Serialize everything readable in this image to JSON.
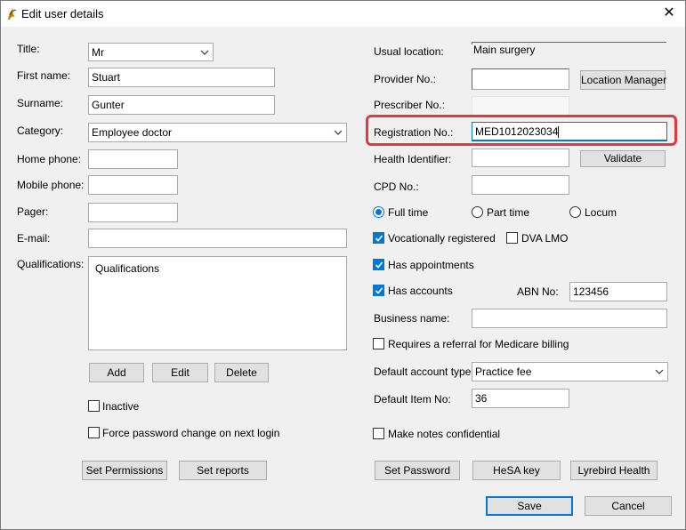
{
  "window": {
    "title": "Edit user details",
    "close_glyph": "✕"
  },
  "left": {
    "title_label": "Title:",
    "title_value": "Mr",
    "first_name_label": "First name:",
    "first_name_value": "Stuart",
    "surname_label": "Surname:",
    "surname_value": "Gunter",
    "category_label": "Category:",
    "category_value": "Employee doctor",
    "home_phone_label": "Home phone:",
    "home_phone_value": "",
    "mobile_phone_label": "Mobile phone:",
    "mobile_phone_value": "",
    "pager_label": "Pager:",
    "pager_value": "",
    "email_label": "E-mail:",
    "email_value": "",
    "qualifications_label": "Qualifications:",
    "qualifications_value": "Qualifications",
    "add_label": "Add",
    "edit_label": "Edit",
    "delete_label": "Delete",
    "inactive_label": "Inactive",
    "inactive_checked": false,
    "force_pw_label": "Force password change on next login",
    "force_pw_checked": false,
    "set_permissions_label": "Set Permissions",
    "set_reports_label": "Set reports"
  },
  "right": {
    "usual_location_label": "Usual location:",
    "usual_location_value": "Main surgery",
    "provider_no_label": "Provider No.:",
    "provider_no_value": "",
    "location_manager_label": "Location Manager",
    "prescriber_no_label": "Prescriber No.:",
    "prescriber_no_value": "",
    "registration_no_label": "Registration No.:",
    "registration_no_value": "MED1012023034",
    "health_identifier_label": "Health Identifier:",
    "health_identifier_value": "",
    "validate_label": "Validate",
    "cpd_no_label": "CPD No.:",
    "cpd_no_value": "",
    "full_time_label": "Full time",
    "part_time_label": "Part time",
    "locum_label": "Locum",
    "employment_selected": "Full time",
    "vocationally_registered_label": "Vocationally registered",
    "vocationally_registered_checked": true,
    "dva_lmo_label": "DVA LMO",
    "dva_lmo_checked": false,
    "has_appointments_label": "Has appointments",
    "has_appointments_checked": true,
    "has_accounts_label": "Has accounts",
    "has_accounts_checked": true,
    "abn_label": "ABN No:",
    "abn_value": "123456",
    "business_name_label": "Business name:",
    "business_name_value": "",
    "requires_referral_label": "Requires a referral for Medicare billing",
    "requires_referral_checked": false,
    "default_account_type_label": "Default account type:",
    "default_account_type_value": "Practice fee",
    "default_item_no_label": "Default Item No:",
    "default_item_no_value": "36",
    "make_notes_confidential_label": "Make notes confidential",
    "make_notes_confidential_checked": false,
    "set_password_label": "Set Password",
    "hesa_key_label": "HeSA key",
    "lyrebird_health_label": "Lyrebird Health"
  },
  "footer": {
    "save_label": "Save",
    "cancel_label": "Cancel"
  },
  "colors": {
    "accent": "#0078d7",
    "highlight": "#e3383f"
  }
}
